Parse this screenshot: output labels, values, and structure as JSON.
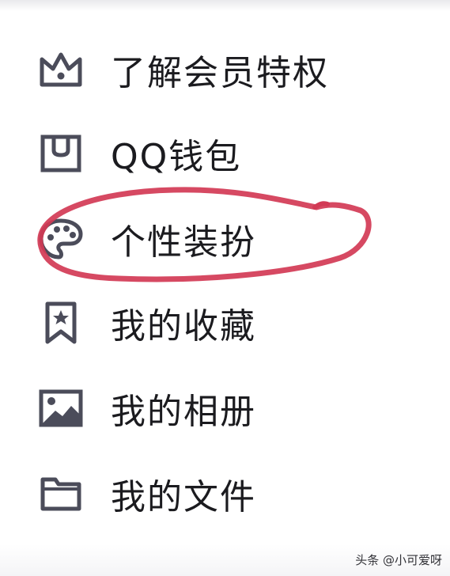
{
  "menu": {
    "items": [
      {
        "label": "了解会员特权",
        "icon": "crown-icon"
      },
      {
        "label": "QQ钱包",
        "icon": "wallet-icon"
      },
      {
        "label": "个性装扮",
        "icon": "palette-icon"
      },
      {
        "label": "我的收藏",
        "icon": "bookmark-star-icon"
      },
      {
        "label": "我的相册",
        "icon": "photo-album-icon"
      },
      {
        "label": "我的文件",
        "icon": "folder-icon"
      }
    ]
  },
  "annotation": {
    "circle_color": "#d23a55"
  },
  "watermark": {
    "text": "头条 @小可爱呀"
  },
  "colors": {
    "icon": "#4b4c5a",
    "text": "#1b1b1f"
  }
}
